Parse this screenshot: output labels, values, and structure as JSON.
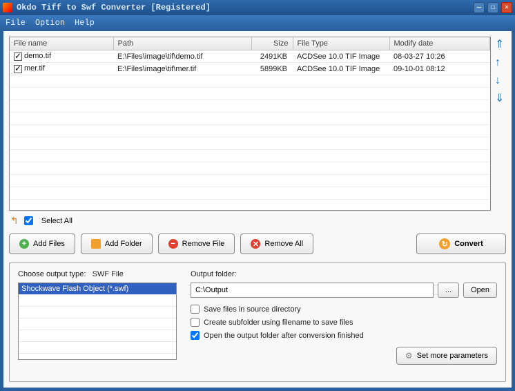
{
  "title": "Okdo Tiff to Swf Converter [Registered]",
  "menu": {
    "file": "File",
    "option": "Option",
    "help": "Help"
  },
  "columns": {
    "name": "File name",
    "path": "Path",
    "size": "Size",
    "type": "File Type",
    "date": "Modify date"
  },
  "files": [
    {
      "name": "demo.tif",
      "path": "E:\\Files\\image\\tif\\demo.tif",
      "size": "2491KB",
      "type": "ACDSee 10.0 TIF Image",
      "date": "08-03-27 10:26",
      "checked": true
    },
    {
      "name": "mer.tif",
      "path": "E:\\Files\\image\\tif\\mer.tif",
      "size": "5899KB",
      "type": "ACDSee 10.0 TIF Image",
      "date": "09-10-01 08:12",
      "checked": true
    }
  ],
  "selectAll": "Select All",
  "buttons": {
    "addFiles": "Add Files",
    "addFolder": "Add Folder",
    "removeFile": "Remove File",
    "removeAll": "Remove All",
    "convert": "Convert"
  },
  "outputType": {
    "label": "Choose output type:",
    "currentType": "SWF File",
    "items": [
      "Shockwave Flash Object (*.swf)"
    ]
  },
  "outputFolder": {
    "label": "Output folder:",
    "value": "C:\\Output",
    "browse": "...",
    "open": "Open"
  },
  "options": {
    "saveSource": "Save files in source directory",
    "createSub": "Create subfolder using filename to save files",
    "openAfter": "Open the output folder after conversion finished"
  },
  "setMore": "Set more parameters"
}
